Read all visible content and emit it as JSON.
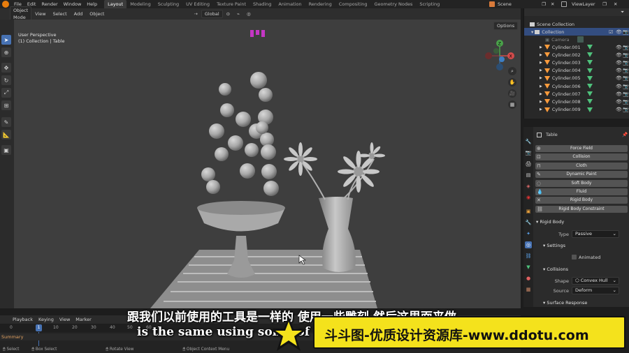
{
  "menus": [
    "File",
    "Edit",
    "Render",
    "Window",
    "Help"
  ],
  "workspaces": [
    "Layout",
    "Modeling",
    "Sculpting",
    "UV Editing",
    "Texture Paint",
    "Shading",
    "Animation",
    "Rendering",
    "Compositing",
    "Geometry Nodes",
    "Scripting"
  ],
  "scene": "Scene",
  "view_layer": "ViewLayer",
  "viewport": {
    "mode": "Object Mode",
    "menu": [
      "View",
      "Select",
      "Add",
      "Object"
    ],
    "transform": "Global",
    "info_line1": "User Perspective",
    "info_line2": "(1) Collection | Table",
    "options": "Options"
  },
  "outliner": {
    "scene_collection": "Scene Collection",
    "collection": "Collection",
    "camera": "Camera",
    "objects": [
      "Cylinder.001",
      "Cylinder.002",
      "Cylinder.003",
      "Cylinder.004",
      "Cylinder.005",
      "Cylinder.006",
      "Cylinder.007",
      "Cylinder.008",
      "Cylinder.009"
    ]
  },
  "properties": {
    "object_name": "Table",
    "physics_buttons": [
      "Force Field",
      "Collision",
      "Cloth",
      "Dynamic Paint",
      "Soft Body",
      "Fluid",
      "Rigid Body",
      "Rigid Body Constraint"
    ],
    "rigid_body": "Rigid Body",
    "type_label": "Type",
    "type_value": "Passive",
    "settings": "Settings",
    "animated": "Animated",
    "collisions": "Collisions",
    "shape_label": "Shape",
    "shape_value": "Convex Hull",
    "source_label": "Source",
    "source_value": "Deform",
    "surface_response": "Surface Response"
  },
  "timeline": {
    "menu": [
      "Playback",
      "Keying",
      "View",
      "Marker"
    ],
    "current_frame": "1",
    "ticks": [
      "0",
      "10",
      "20",
      "30",
      "40",
      "50",
      "60"
    ],
    "summary": "Summary"
  },
  "statusbar": [
    "Select",
    "Box Select",
    "Rotate View",
    "Object Context Menu"
  ],
  "subtitle_cn": "跟我们以前使用的工具是一样的 使用一些雕刻 然后这里面来做",
  "subtitle_en": "is the same using some of the",
  "watermark": "斗斗图-优质设计资源库-www.ddotu.com",
  "colors": {
    "accent": "#4772b3",
    "active_object": "#ff9c3c",
    "mesh_data": "#4fc27c",
    "watermark_bg": "#f4e21c"
  }
}
